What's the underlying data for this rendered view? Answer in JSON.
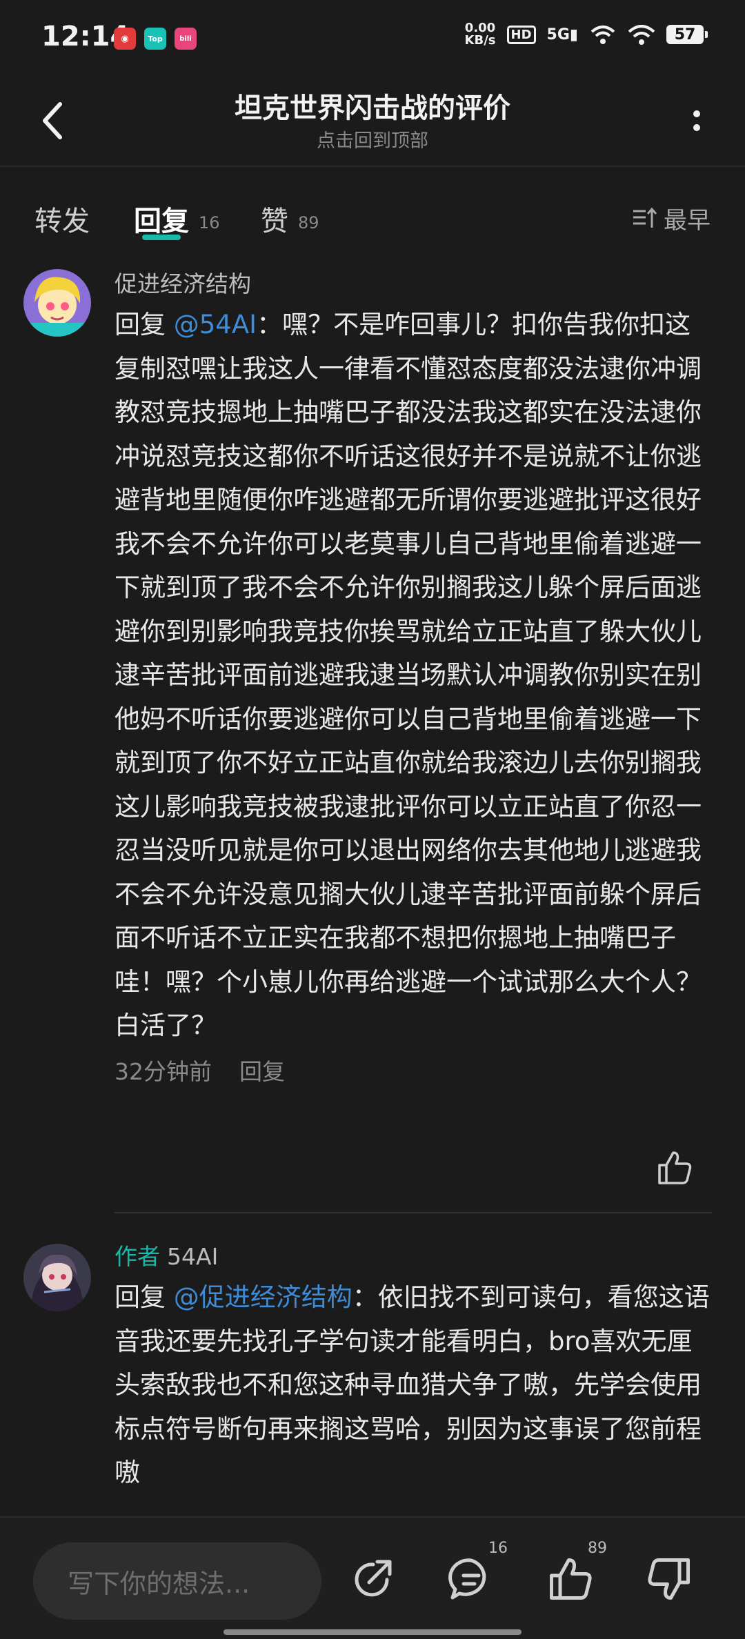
{
  "status_bar": {
    "time": "12:14",
    "net_speed_value": "0.00",
    "net_speed_unit": "KB/s",
    "hd": "HD",
    "signal": "5G",
    "battery": "57"
  },
  "header": {
    "title": "坦克世界闪击战的评价",
    "subtitle": "点击回到顶部"
  },
  "tabs": [
    {
      "label": "转发",
      "count": ""
    },
    {
      "label": "回复",
      "count": "16"
    },
    {
      "label": "赞",
      "count": "89"
    }
  ],
  "sort_label": "最早",
  "comments": [
    {
      "author": "促进经济结构",
      "author_tag": "",
      "reply_prefix": "回复",
      "mention": "@54AI",
      "text": "：嘿？不是咋回事儿？扣你告我你扣这复制怼嘿让我这人一律看不懂怼态度都没法逮你冲调教怼竞技摁地上抽嘴巴子都没法我这都实在没法逮你冲说怼竞技这都你不听话这很好并不是说就不让你逃避背地里随便你咋逃避都无所谓你要逃避批评这很好我不会不允许你可以老莫事儿自己背地里偷着逃避一下就到顶了我不会不允许你别搁我这儿躲个屏后面逃避你到别影响我竞技你挨骂就给立正站直了躲大伙儿逮辛苦批评面前逃避我逮当场默认冲调教你别实在别他妈不听话你要逃避你可以自己背地里偷着逃避一下就到顶了你不好立正站直你就给我滚边儿去你别搁我这儿影响我竞技被我逮批评你可以立正站直了你忍一忍当没听见就是你可以退出网络你去其他地儿逃避我不会不允许没意见搁大伙儿逮辛苦批评面前躲个屏后面不听话不立正实在我都不想把你摁地上抽嘴巴子哇！嘿？个小崽儿你再给逃避一个试试那么大个人？白活了？",
      "time": "32分钟前",
      "reply_label": "回复"
    },
    {
      "author": "54AI",
      "author_tag": "作者",
      "reply_prefix": "回复",
      "mention": "@促进经济结构",
      "text": "：依旧找不到可读句，看您这语音我还要先找孔子学句读才能看明白，bro喜欢无厘头索敌我也不和您这种寻血猎犬争了嗷，先学会使用标点符号断句再来搁这骂哈，别因为这事误了您前程嗷",
      "time": "",
      "reply_label": ""
    }
  ],
  "bottom_bar": {
    "input_placeholder": "写下你的想法...",
    "comment_count": "16",
    "like_count": "89"
  },
  "colors": {
    "accent": "#19b8a8",
    "mention": "#3e8bd6",
    "background": "#1b1b1b"
  }
}
